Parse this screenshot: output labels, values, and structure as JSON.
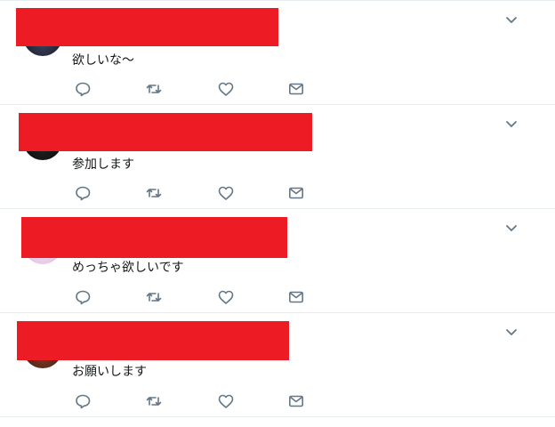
{
  "tweets": [
    {
      "text": "欲しいな～"
    },
    {
      "text": "参加します"
    },
    {
      "text": "めっちゃ欲しいです"
    },
    {
      "text": "お願いします"
    }
  ],
  "icons": {
    "caret": "chevron-down-icon",
    "reply": "reply-icon",
    "retweet": "retweet-icon",
    "like": "heart-icon",
    "dm": "envelope-icon"
  },
  "colors": {
    "redaction": "#ed1c24",
    "icon": "#657786",
    "divider": "#e6ecf0",
    "text": "#14171a"
  }
}
